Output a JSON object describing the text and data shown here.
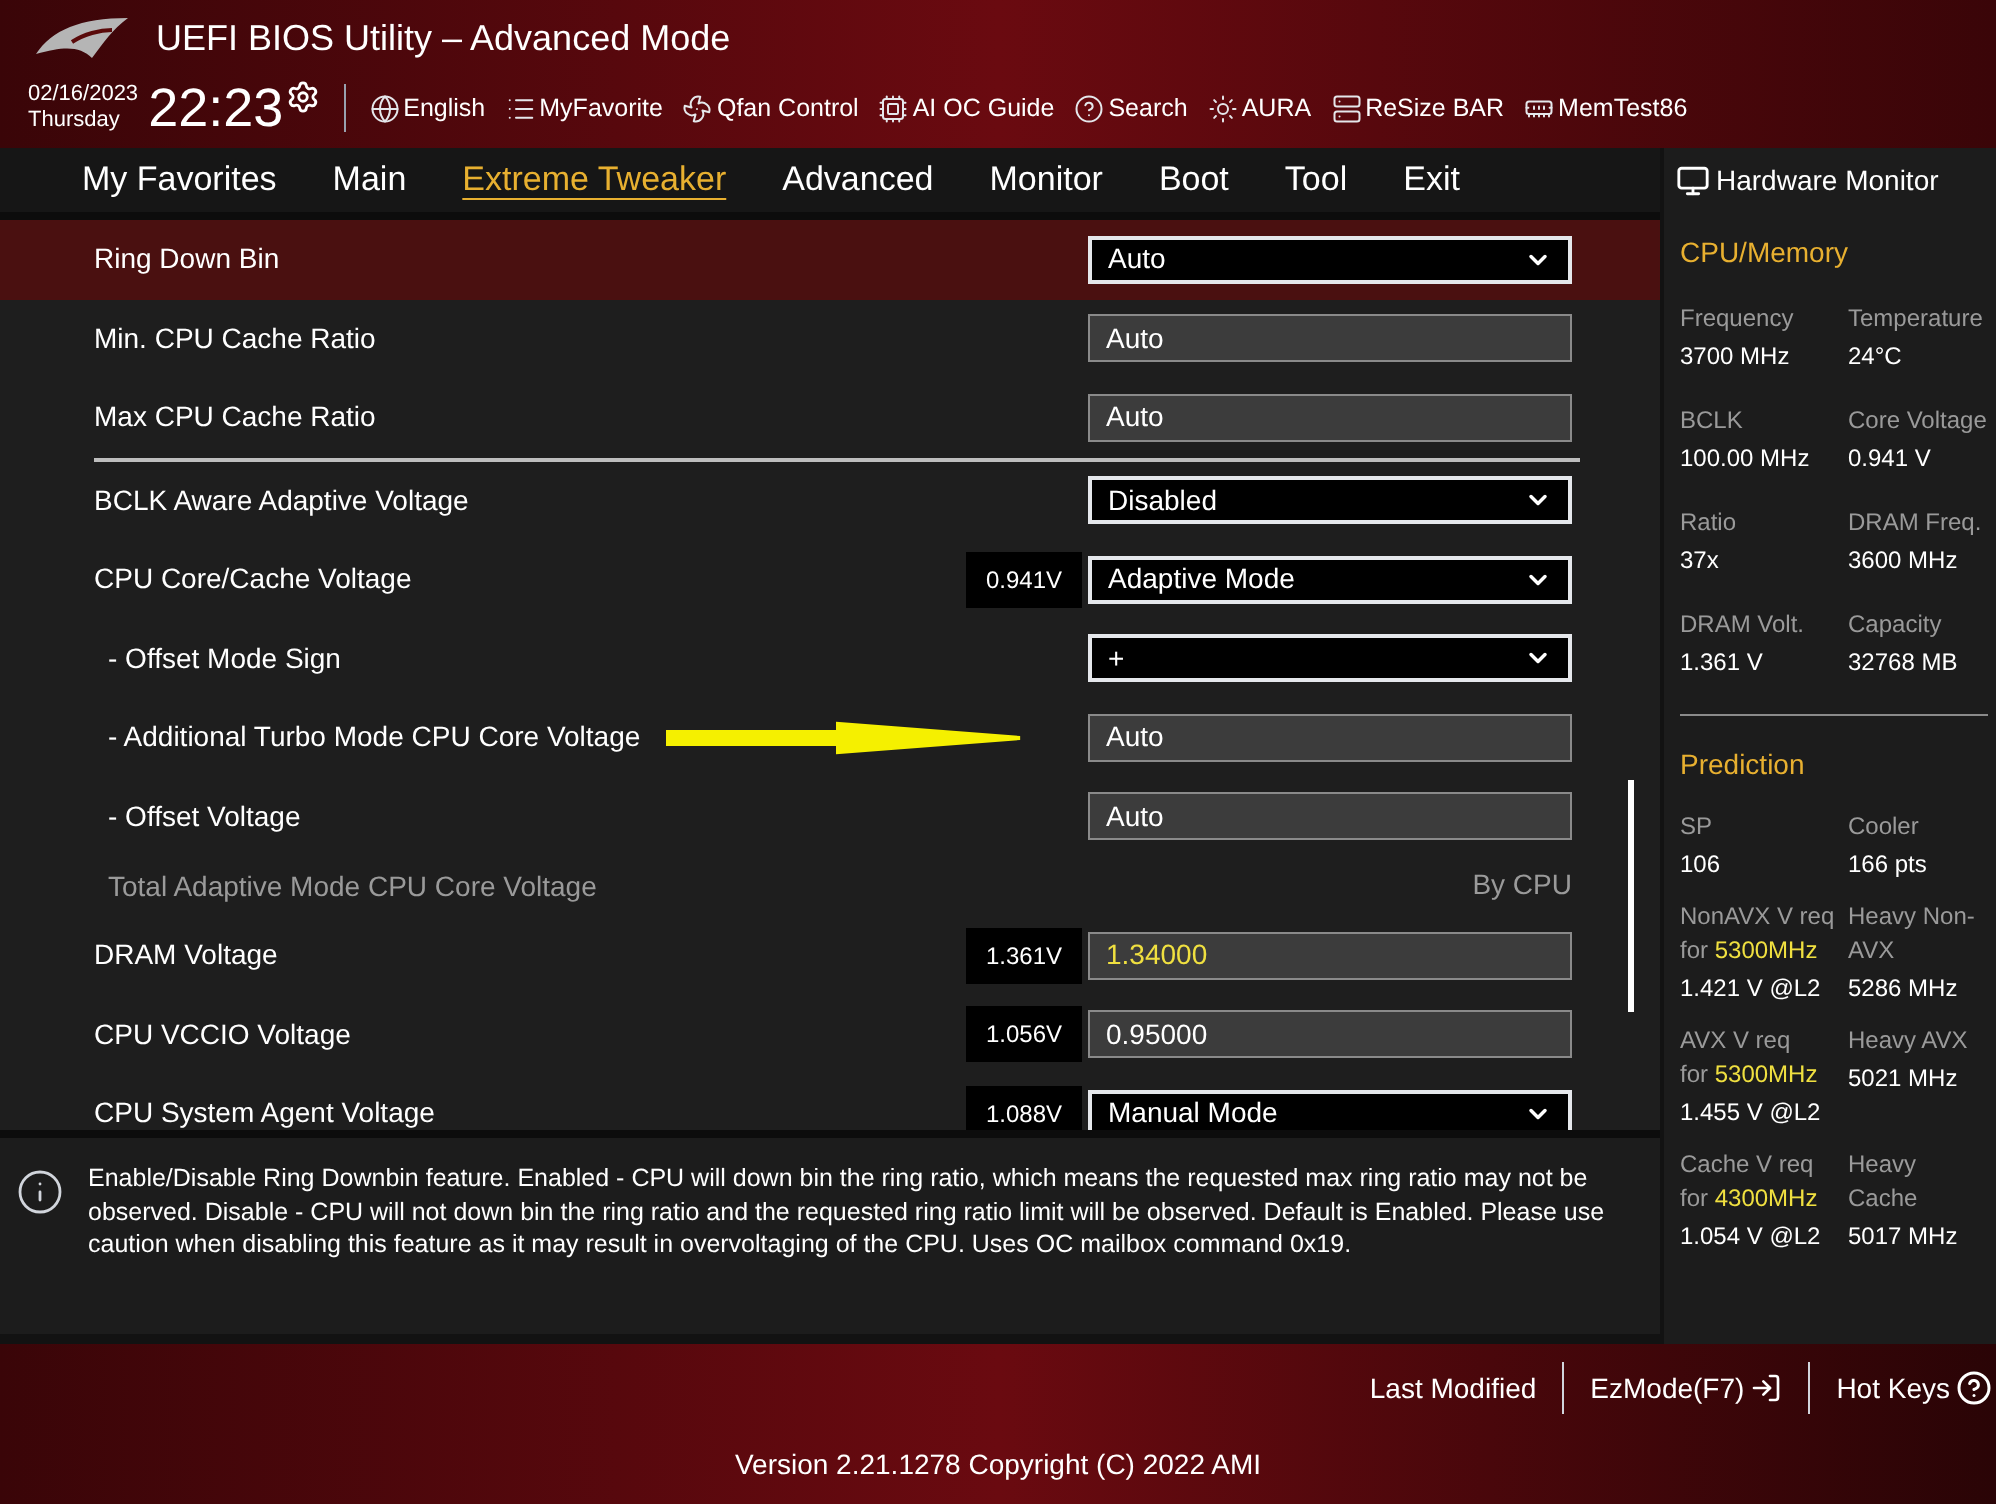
{
  "window": {
    "title": "UEFI BIOS Utility – Advanced Mode"
  },
  "clock": {
    "date": "02/16/2023",
    "weekday": "Thursday",
    "time": "22:23"
  },
  "toolbar": [
    {
      "kind": "globe",
      "label": "English"
    },
    {
      "kind": "list",
      "label": "MyFavorite"
    },
    {
      "kind": "fan",
      "label": "Qfan Control"
    },
    {
      "kind": "chip",
      "label": "AI OC Guide"
    },
    {
      "kind": "help",
      "label": "Search"
    },
    {
      "kind": "aura",
      "label": "AURA"
    },
    {
      "kind": "bar",
      "label": "ReSize BAR"
    },
    {
      "kind": "memory",
      "label": "MemTest86"
    }
  ],
  "tabs": [
    {
      "label": "My Favorites",
      "selected": false
    },
    {
      "label": "Main",
      "selected": false
    },
    {
      "label": "Extreme Tweaker",
      "selected": true
    },
    {
      "label": "Advanced",
      "selected": false
    },
    {
      "label": "Monitor",
      "selected": false
    },
    {
      "label": "Boot",
      "selected": false
    },
    {
      "label": "Tool",
      "selected": false
    },
    {
      "label": "Exit",
      "selected": false
    }
  ],
  "settings": [
    {
      "kind": "dropdown",
      "label": "Ring Down Bin",
      "value": "Auto",
      "selected": true
    },
    {
      "kind": "field",
      "label": "Min. CPU Cache Ratio",
      "value": "Auto",
      "selected": false
    },
    {
      "kind": "field",
      "label": "Max CPU Cache Ratio",
      "value": "Auto",
      "selected": false
    },
    {
      "kind": "divider"
    },
    {
      "kind": "dropdown",
      "label": "BCLK Aware Adaptive Voltage",
      "value": "Disabled",
      "selected": false
    },
    {
      "kind": "dropdown",
      "label": "CPU Core/Cache Voltage",
      "reading": "0.941V",
      "value": "Adaptive Mode",
      "selected": false,
      "children": [
        {
          "kind": "dropdown",
          "label": "- Offset Mode Sign",
          "value": "+",
          "selected": false
        },
        {
          "kind": "field",
          "label": "- Additional Turbo Mode CPU Core Voltage",
          "value": "Auto",
          "selected": false,
          "arrow": true
        },
        {
          "kind": "field",
          "label": "- Offset Voltage",
          "value": "Auto",
          "selected": false
        },
        {
          "kind": "readonly",
          "label": "Total Adaptive Mode CPU Core Voltage",
          "value": "By CPU",
          "selected": false
        }
      ]
    },
    {
      "kind": "field",
      "label": "DRAM Voltage",
      "reading": "1.361V",
      "value": "1.34000",
      "modified": true,
      "selected": false
    },
    {
      "kind": "field",
      "label": "CPU VCCIO Voltage",
      "reading": "1.056V",
      "value": "0.95000",
      "modified": false,
      "selected": false
    },
    {
      "kind": "dropdown",
      "label": "CPU System Agent Voltage",
      "reading": "1.088V",
      "value": "Manual Mode",
      "selected": false
    }
  ],
  "help": {
    "text": "Enable/Disable Ring Downbin feature. Enabled - CPU will down bin the ring ratio, which means the requested max ring ratio may not be observed. Disable - CPU will not down bin the ring ratio and the requested ring ratio limit will be observed. Default is Enabled. Please use caution when disabling this feature as it may result in overvoltaging of the CPU. Uses OC mailbox command 0x19."
  },
  "hardware_monitor": {
    "title": "Hardware Monitor",
    "cpu_memory": {
      "title": "CPU/Memory",
      "items": [
        {
          "label": "Frequency",
          "value": "3700 MHz"
        },
        {
          "label": "Temperature",
          "value": "24°C"
        },
        {
          "label": "BCLK",
          "value": "100.00 MHz"
        },
        {
          "label": "Core Voltage",
          "value": "0.941 V"
        },
        {
          "label": "Ratio",
          "value": "37x"
        },
        {
          "label": "DRAM Freq.",
          "value": "3600 MHz"
        },
        {
          "label": "DRAM Volt.",
          "value": "1.361 V"
        },
        {
          "label": "Capacity",
          "value": "32768 MB"
        }
      ]
    },
    "prediction": {
      "title": "Prediction",
      "rows": [
        {
          "left": {
            "label": "SP",
            "value": "106"
          },
          "right": {
            "label": "Cooler",
            "value": "166 pts"
          }
        },
        {
          "left": {
            "label": "NonAVX V req for",
            "freq": "5300MHz",
            "value": "1.421 V @L2"
          },
          "right": {
            "label": "Heavy Non-AVX",
            "value": "5286 MHz"
          }
        },
        {
          "left": {
            "label": "AVX V req    for",
            "freq": "5300MHz",
            "value": "1.455 V @L2"
          },
          "right": {
            "label": "Heavy AVX",
            "value": "5021 MHz"
          }
        },
        {
          "left": {
            "label": "Cache V req for",
            "freq": "4300MHz",
            "value": "1.054 V @L2"
          },
          "right": {
            "label": "Heavy Cache",
            "value": "5017 MHz"
          }
        }
      ]
    }
  },
  "footer": {
    "actions": [
      {
        "kind": "plain",
        "label": "Last Modified"
      },
      {
        "kind": "exit",
        "label": "EzMode(F7)"
      },
      {
        "kind": "help",
        "label": "Hot Keys"
      }
    ],
    "version": "Version 2.21.1278 Copyright (C) 2022 AMI"
  }
}
